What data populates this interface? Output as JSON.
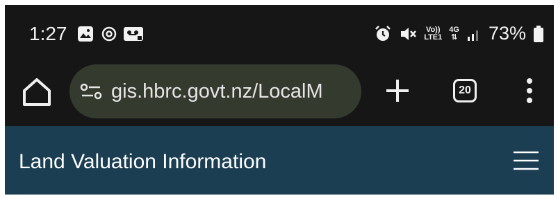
{
  "status_bar": {
    "time": "1:27",
    "left_icons": [
      "image-icon",
      "sync-icon",
      "voicemail-icon"
    ],
    "network_volte": "Vo))",
    "network_lte": "LTE1",
    "network_type": "4G",
    "battery_percent": "73%",
    "battery_level": 0.73
  },
  "browser": {
    "url": "gis.hbrc.govt.nz/LocalM",
    "tab_count": "20"
  },
  "page": {
    "title": "Land Valuation Information"
  },
  "colors": {
    "status_bg": "#161616",
    "url_pill": "#353a2f",
    "page_header": "#1b3e52"
  }
}
